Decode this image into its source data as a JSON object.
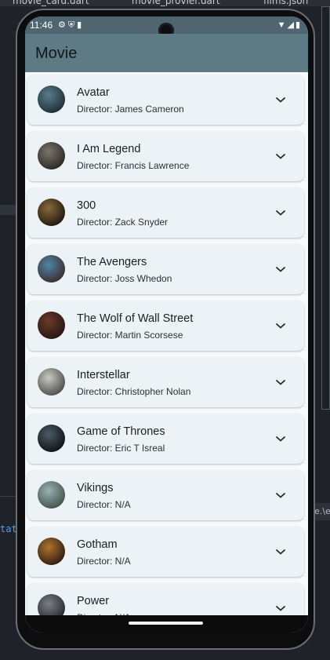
{
  "ide": {
    "tabs": [
      "movie_card.dart",
      "movie_provier.dart",
      "films.json"
    ],
    "code_snippet": "tat",
    "right_snippet": "e.\\e"
  },
  "status_bar": {
    "time": "11:46",
    "left_icons": [
      "gear-icon",
      "shield-icon",
      "sd-card-icon"
    ],
    "right_icons": [
      "wifi-icon",
      "signal-icon",
      "battery-icon"
    ]
  },
  "app_bar": {
    "title": "Movie"
  },
  "colors": {
    "app_bar": "#5e7a84",
    "status_bar": "#4f6670",
    "card": "#edf2f6",
    "list_bg": "#f7fafc"
  },
  "movies": [
    {
      "title": "Avatar",
      "director": "Director: James Cameron",
      "avatar_colors": [
        "#5a7d8a",
        "#1d2b35"
      ]
    },
    {
      "title": "I Am Legend",
      "director": "Director: Francis Lawrence",
      "avatar_colors": [
        "#7a746c",
        "#2a2622"
      ]
    },
    {
      "title": "300",
      "director": "Director: Zack Snyder",
      "avatar_colors": [
        "#8a6a3a",
        "#1c150d"
      ]
    },
    {
      "title": "The Avengers",
      "director": "Director: Joss Whedon",
      "avatar_colors": [
        "#4f86a6",
        "#3b2a2a"
      ]
    },
    {
      "title": "The Wolf of Wall Street",
      "director": "Director: Martin Scorsese",
      "avatar_colors": [
        "#6a3a2a",
        "#241512"
      ]
    },
    {
      "title": "Interstellar",
      "director": "Director: Christopher Nolan",
      "avatar_colors": [
        "#c8c8c4",
        "#4a4a48"
      ]
    },
    {
      "title": "Game of Thrones",
      "director": "Director: Eric T Isreal",
      "avatar_colors": [
        "#4c5a66",
        "#0d1216"
      ]
    },
    {
      "title": "Vikings",
      "director": "Director: N/A",
      "avatar_colors": [
        "#9bb0b6",
        "#3e5044"
      ]
    },
    {
      "title": "Gotham",
      "director": "Director: N/A",
      "avatar_colors": [
        "#b0742c",
        "#2a1a10"
      ]
    },
    {
      "title": "Power",
      "director": "Director: N/A",
      "avatar_colors": [
        "#7c7e86",
        "#24262c"
      ]
    }
  ]
}
